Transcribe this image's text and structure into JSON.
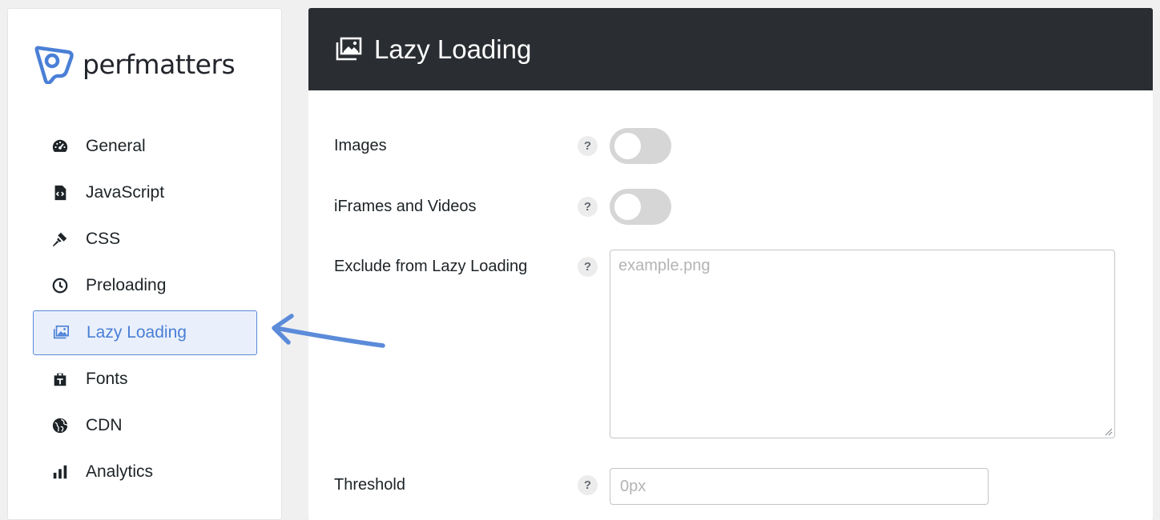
{
  "brand": {
    "name": "perfmatters",
    "accent": "#4a7fd6"
  },
  "sidebar": {
    "items": [
      {
        "label": "General",
        "icon": "dashboard-gauge-icon",
        "active": false
      },
      {
        "label": "JavaScript",
        "icon": "code-file-icon",
        "active": false
      },
      {
        "label": "CSS",
        "icon": "paint-brush-icon",
        "active": false
      },
      {
        "label": "Preloading",
        "icon": "clock-icon",
        "active": false
      },
      {
        "label": "Lazy Loading",
        "icon": "images-stack-icon",
        "active": true
      },
      {
        "label": "Fonts",
        "icon": "font-bag-icon",
        "active": false
      },
      {
        "label": "CDN",
        "icon": "globe-icon",
        "active": false
      },
      {
        "label": "Analytics",
        "icon": "bar-chart-icon",
        "active": false
      }
    ]
  },
  "main": {
    "title": "Lazy Loading",
    "title_icon": "images-stack-icon",
    "settings": {
      "images": {
        "label": "Images",
        "help": "?",
        "enabled": false
      },
      "iframes": {
        "label": "iFrames and Videos",
        "help": "?",
        "enabled": false
      },
      "exclude": {
        "label": "Exclude from Lazy Loading",
        "help": "?",
        "placeholder": "example.png",
        "value": ""
      },
      "threshold": {
        "label": "Threshold",
        "help": "?",
        "placeholder": "0px",
        "value": ""
      }
    }
  },
  "annotation": {
    "type": "arrow",
    "color": "#5b8bd9",
    "points_to": "Lazy Loading"
  }
}
